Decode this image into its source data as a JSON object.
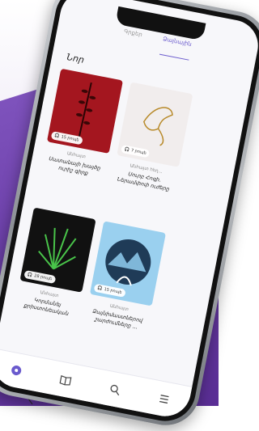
{
  "tabs": [
    {
      "label": "Գրքեր",
      "active": false
    },
    {
      "label": "Ձայնային",
      "active": true
    }
  ],
  "section": {
    "title": "Նոր"
  },
  "cards": [
    {
      "author": "Անհայտ",
      "title": "Սատանայի խայծը ուրիշ գիրք",
      "duration": "15 րոպե",
      "bg": "#a4161f",
      "headphones_icon": "headphones-icon"
    },
    {
      "author": "Անհայտ հեղ...",
      "title": "Սուրբ Հոգի. Ներամփոփ ուժերը",
      "duration": "7 րոպե",
      "bg": "#f1eded",
      "headphones_icon": "headphones-icon"
    },
    {
      "author": "Անհայտ",
      "title": "Կորմանեյ քրիստոնեական",
      "duration": "28 րոպե",
      "bg": "#111111",
      "headphones_icon": "headphones-icon"
    },
    {
      "author": "Անհայտ",
      "title": "Ձայնիմաստներով շարժումները ... ",
      "duration": "15 րոպե",
      "bg": "#9ad0ef",
      "headphones_icon": "headphones-icon"
    }
  ],
  "nav": [
    {
      "icon": "home-icon",
      "active": true
    },
    {
      "icon": "book-icon",
      "active": false
    },
    {
      "icon": "search-icon",
      "active": false
    },
    {
      "icon": "menu-icon",
      "active": false
    }
  ],
  "colors": {
    "accent": "#6a5acd",
    "violet_bg": "#6b3ea8"
  }
}
